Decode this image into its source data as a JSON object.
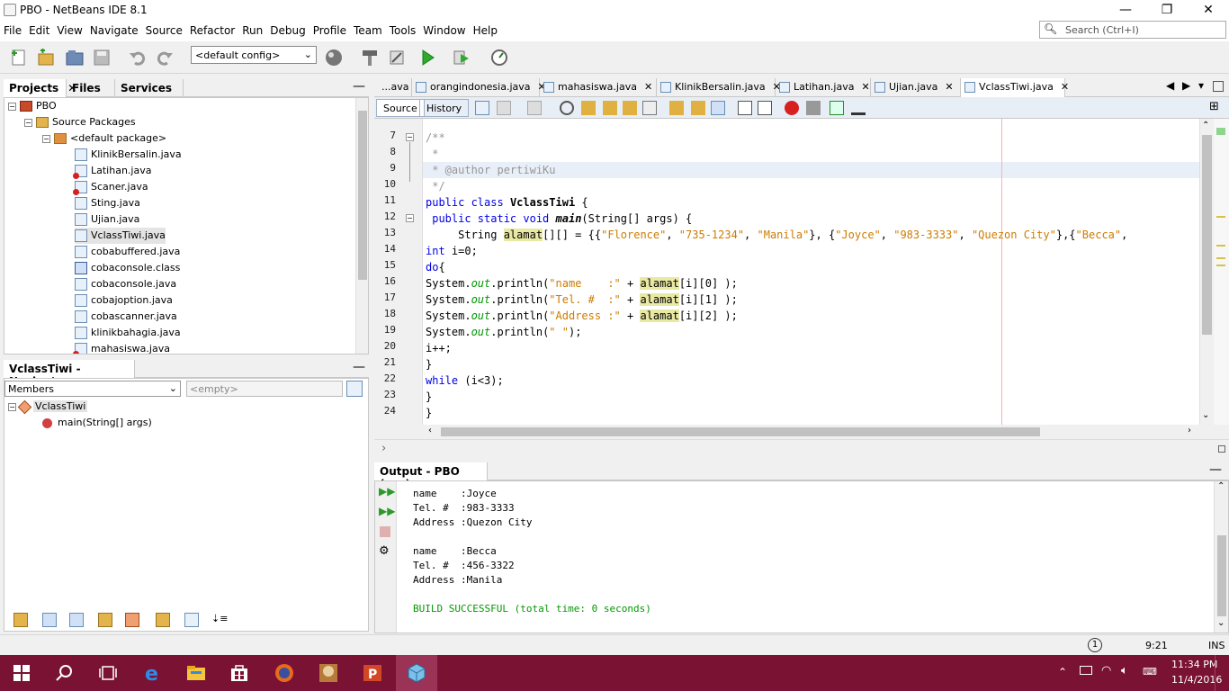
{
  "window": {
    "title": "PBO - NetBeans IDE 8.1"
  },
  "menu": [
    "File",
    "Edit",
    "View",
    "Navigate",
    "Source",
    "Refactor",
    "Run",
    "Debug",
    "Profile",
    "Team",
    "Tools",
    "Window",
    "Help"
  ],
  "search": {
    "placeholder": "Search (Ctrl+I)"
  },
  "toolbar": {
    "config": "<default config>"
  },
  "projects_panel": {
    "tabs": [
      "Projects",
      "Files",
      "Services"
    ],
    "root": "PBO",
    "source_packages": "Source Packages",
    "default_package": "<default package>",
    "files": [
      "KlinikBersalin.java",
      "Latihan.java",
      "Scaner.java",
      "Sting.java",
      "Ujian.java",
      "VclassTiwi.java",
      "cobabuffered.java",
      "cobaconsole.class",
      "cobaconsole.java",
      "cobajoption.java",
      "cobascanner.java",
      "klinikbahagia.java",
      "mahasiswa.java"
    ]
  },
  "navigator": {
    "title": "VclassTiwi - Navigator",
    "members_label": "Members",
    "filter_placeholder": "<empty>",
    "class_name": "VclassTiwi",
    "method": "main(String[] args)"
  },
  "editor": {
    "tabs": [
      "...ava",
      "orangindonesia.java",
      "mahasiswa.java",
      "KlinikBersalin.java",
      "Latihan.java",
      "Ujian.java",
      "VclassTiwi.java"
    ],
    "source_label": "Source",
    "history_label": "History",
    "line_numbers": [
      "7",
      "8",
      "9",
      "10",
      "11",
      "12",
      "13",
      "14",
      "15",
      "16",
      "17",
      "18",
      "19",
      "20",
      "21",
      "22",
      "23",
      "24"
    ],
    "code": {
      "l7": "/**",
      "l8": " *",
      "l9": " * @author pertiwiKu",
      "l10": " */",
      "l11_kw": "public class",
      "l11_name": "VclassTiwi",
      "l11_rest": " {",
      "l12_kw": " public static void",
      "l12_name": "main",
      "l12_rest": "(String[] args) {",
      "l13_a": "     String ",
      "l13_var": "alamat",
      "l13_b": "[][] = {{",
      "l13_s1": "\"Florence\"",
      "l13_c1": ", ",
      "l13_s2": "\"735-1234\"",
      "l13_c2": ", ",
      "l13_s3": "\"Manila\"",
      "l13_c3": "}, {",
      "l13_s4": "\"Joyce\"",
      "l13_c4": ", ",
      "l13_s5": "\"983-3333\"",
      "l13_c5": ", ",
      "l13_s6": "\"Quezon City\"",
      "l13_c6": "},{",
      "l13_s7": "\"Becca\"",
      "l13_c7": ",",
      "l14_kw": "int",
      "l14_rest": " i=0;",
      "l15_kw": "do",
      "l15_rest": "{",
      "print_pre": "System.",
      "print_out": "out",
      "print_mid": ".println(",
      "l16_str": "\"name    :\"",
      "l17_str": "\"Tel. #  :\"",
      "l18_str": "\"Address :\"",
      "l19_str": "\" \"",
      "plus": " + ",
      "var": "alamat",
      "idx0": "[i][0] );",
      "idx1": "[i][1] );",
      "idx2": "[i][2] );",
      "l19_end": ");",
      "l20": "i++;",
      "l21": "}",
      "l22_kw": "while",
      "l22_rest": " (i<3);",
      "l23": "}",
      "l24": "}"
    }
  },
  "output": {
    "title": "Output - PBO (run)",
    "lines": [
      "name    :Joyce",
      "Tel. #  :983-3333",
      "Address :Quezon City",
      "",
      "name    :Becca",
      "Tel. #  :456-3322",
      "Address :Manila",
      "",
      "BUILD SUCCESSFUL (total time: 0 seconds)"
    ]
  },
  "status": {
    "position": "9:21",
    "mode": "INS"
  },
  "taskbar": {
    "time": "11:34 PM",
    "date": "11/4/2016"
  },
  "colors": {
    "taskbar": "#7a1234",
    "keyword": "#0000e6",
    "string": "#ce7b00",
    "build_success": "#009900"
  }
}
